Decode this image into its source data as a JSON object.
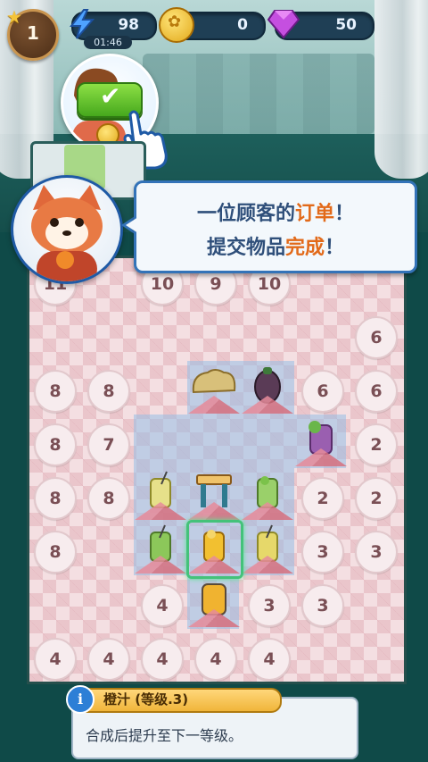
{
  "hud": {
    "level": "1",
    "energy": "98",
    "energy_timer": "01:46",
    "coins": "0",
    "gems": "50"
  },
  "dialog": {
    "line1_pre": "一位顾客的",
    "line1_highlight": "订单",
    "line1_post": "！",
    "line2_pre": "提交物品",
    "line2_highlight": "完成",
    "line2_post": "！"
  },
  "info": {
    "title": "橙汁 (等级.3)",
    "description": "合成后提升至下一等级。",
    "icon_glyph": "i"
  },
  "board": {
    "locked_numbers": [
      {
        "n": "11"
      },
      {
        "n": "10"
      },
      {
        "n": "9"
      },
      {
        "n": "10"
      },
      {
        "n": "6"
      },
      {
        "n": "8"
      },
      {
        "n": "8"
      },
      {
        "n": "6"
      },
      {
        "n": "6"
      },
      {
        "n": "8"
      },
      {
        "n": "7"
      },
      {
        "n": "2"
      },
      {
        "n": "8"
      },
      {
        "n": "8"
      },
      {
        "n": "2"
      },
      {
        "n": "2"
      },
      {
        "n": "8"
      },
      {
        "n": "3"
      },
      {
        "n": "3"
      },
      {
        "n": "4"
      },
      {
        "n": "3"
      },
      {
        "n": "3"
      },
      {
        "n": "4"
      },
      {
        "n": "4"
      },
      {
        "n": "4"
      },
      {
        "n": "4"
      },
      {
        "n": "4"
      }
    ],
    "items": [
      "bread-item",
      "eggplant-item",
      "smoothie-item",
      "lemonade-item",
      "stool-item",
      "green-juice-item",
      "green-juice-item-2",
      "orange-juice-item",
      "orange-juice-item-2",
      "orange-juice-item-3"
    ]
  }
}
